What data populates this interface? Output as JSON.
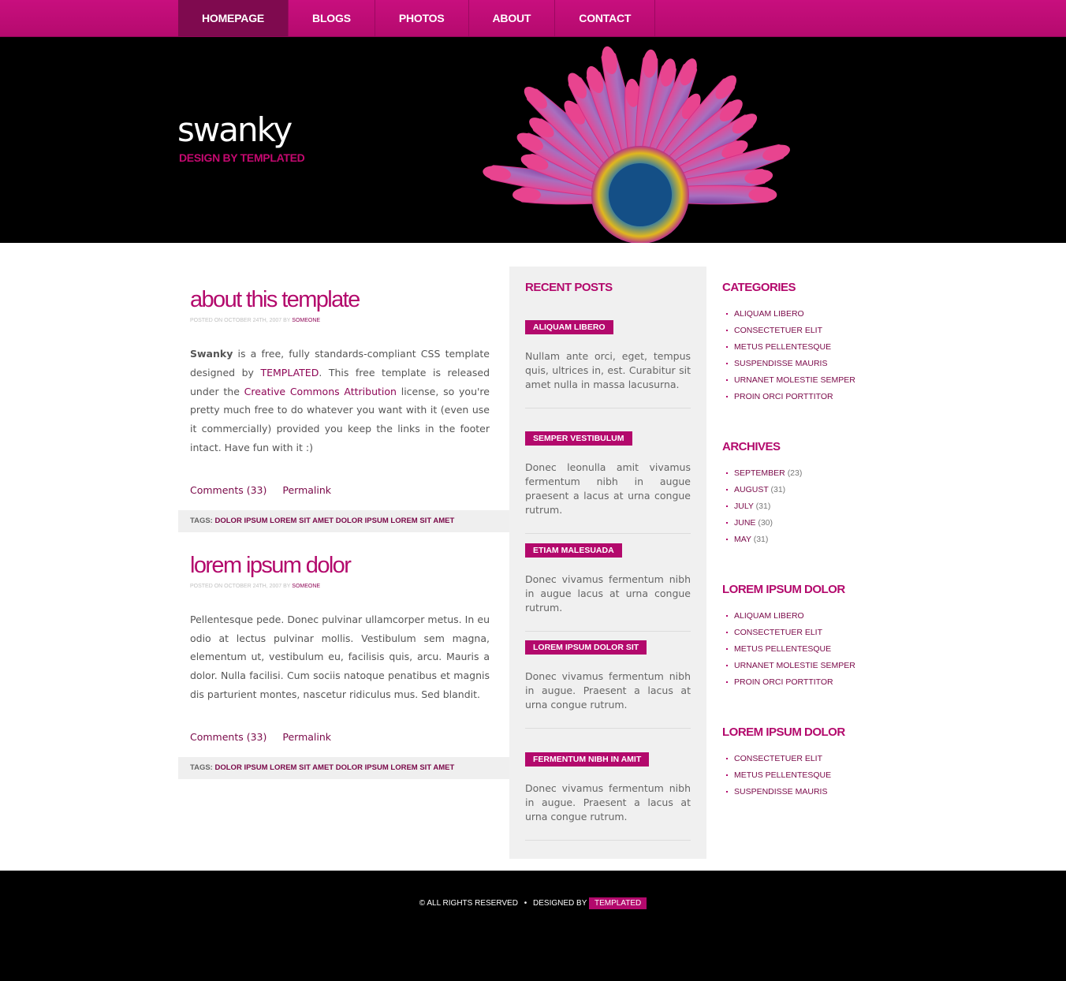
{
  "nav": {
    "items": [
      {
        "label": "HOMEPAGE",
        "active": true
      },
      {
        "label": "BLOGS"
      },
      {
        "label": "PHOTOS"
      },
      {
        "label": "ABOUT"
      },
      {
        "label": "CONTACT"
      }
    ]
  },
  "header": {
    "title": "swanky",
    "subtitle": "DESIGN BY TEMPLATED"
  },
  "posts": [
    {
      "title": "about this template",
      "byline_prefix": "POSTED ON OCTOBER 24TH, 2007 BY",
      "author": "SOMEONE",
      "body_strong": "Swanky",
      "body_1": " is a free, fully standards-compliant CSS template designed by ",
      "body_link_1": "TEMPLATED",
      "body_2": ". This free template is released under the ",
      "body_link_2": "Creative Commons Attribution",
      "body_3": " license, so you're pretty much free to do whatever you want with it (even use it commercially) provided you keep the links in the footer intact. Have fun with it :)",
      "comments": "Comments (33)",
      "permalink": "Permalink",
      "tags_label": "TAGS:",
      "tags": "DOLOR IPSUM LOREM SIT AMET DOLOR IPSUM LOREM SIT AMET"
    },
    {
      "title": "lorem ipsum dolor",
      "byline_prefix": "POSTED ON OCTOBER 24TH, 2007 BY",
      "author": "SOMEONE",
      "body": "Pellentesque pede. Donec pulvinar ullamcorper metus. In eu odio at lectus pulvinar mollis. Vestibulum sem magna, elementum ut, vestibulum eu, facilisis quis, arcu. Mauris a dolor. Nulla facilisi. Cum sociis natoque penatibus et magnis dis parturient montes, nascetur ridiculus mus. Sed blandit.",
      "comments": "Comments (33)",
      "permalink": "Permalink",
      "tags_label": "TAGS:",
      "tags": "DOLOR IPSUM LOREM SIT AMET DOLOR IPSUM LOREM SIT AMET"
    }
  ],
  "recent_posts": {
    "heading": "RECENT POSTS",
    "items": [
      {
        "title": "ALIQUAM LIBERO",
        "text": "Nullam ante orci, eget, tempus quis, ultrices in, est. Curabitur sit amet nulla in massa lacusurna."
      },
      {
        "title": "SEMPER VESTIBULUM",
        "text": "Donec leonulla amit vivamus fermentum nibh in augue praesent a lacus at urna congue rutrum."
      },
      {
        "title": "ETIAM MALESUADA",
        "text": "Donec vivamus fermentum nibh in augue lacus at urna congue rutrum."
      },
      {
        "title": "LOREM IPSUM DOLOR SIT",
        "text": "Donec vivamus fermentum nibh in augue. Praesent a lacus at urna congue rutrum."
      },
      {
        "title": "FERMENTUM NIBH IN AMIT",
        "text": "Donec vivamus fermentum nibh in augue. Praesent a lacus at urna congue rutrum."
      }
    ]
  },
  "categories": {
    "heading": "CATEGORIES",
    "items": [
      "ALIQUAM LIBERO",
      "CONSECTETUER ELIT",
      "METUS PELLENTESQUE",
      "SUSPENDISSE MAURIS",
      "URNANET MOLESTIE SEMPER",
      "PROIN ORCI PORTTITOR"
    ]
  },
  "archives": {
    "heading": "ARCHIVES",
    "items": [
      {
        "label": "SEPTEMBER",
        "count": "(23)"
      },
      {
        "label": "AUGUST",
        "count": "(31)"
      },
      {
        "label": "JULY",
        "count": "(31)"
      },
      {
        "label": "JUNE",
        "count": "(30)"
      },
      {
        "label": "MAY",
        "count": "(31)"
      }
    ]
  },
  "lorem1": {
    "heading": "LOREM IPSUM DOLOR",
    "items": [
      "ALIQUAM LIBERO",
      "CONSECTETUER ELIT",
      "METUS PELLENTESQUE",
      "URNANET MOLESTIE SEMPER",
      "PROIN ORCI PORTTITOR"
    ]
  },
  "lorem2": {
    "heading": "LOREM IPSUM DOLOR",
    "items": [
      "CONSECTETUER ELIT",
      "METUS PELLENTESQUE",
      "SUSPENDISSE MAURIS"
    ]
  },
  "footer": {
    "rights": "© ALL RIGHTS RESERVED",
    "sep": "•",
    "designed_by": "DESIGNED BY",
    "designer": "TEMPLATED"
  },
  "colors": {
    "accent": "#b3096c",
    "nav_bg": "#c80f7e",
    "nav_active": "#7f0a4f",
    "dark_link": "#7a0949"
  }
}
